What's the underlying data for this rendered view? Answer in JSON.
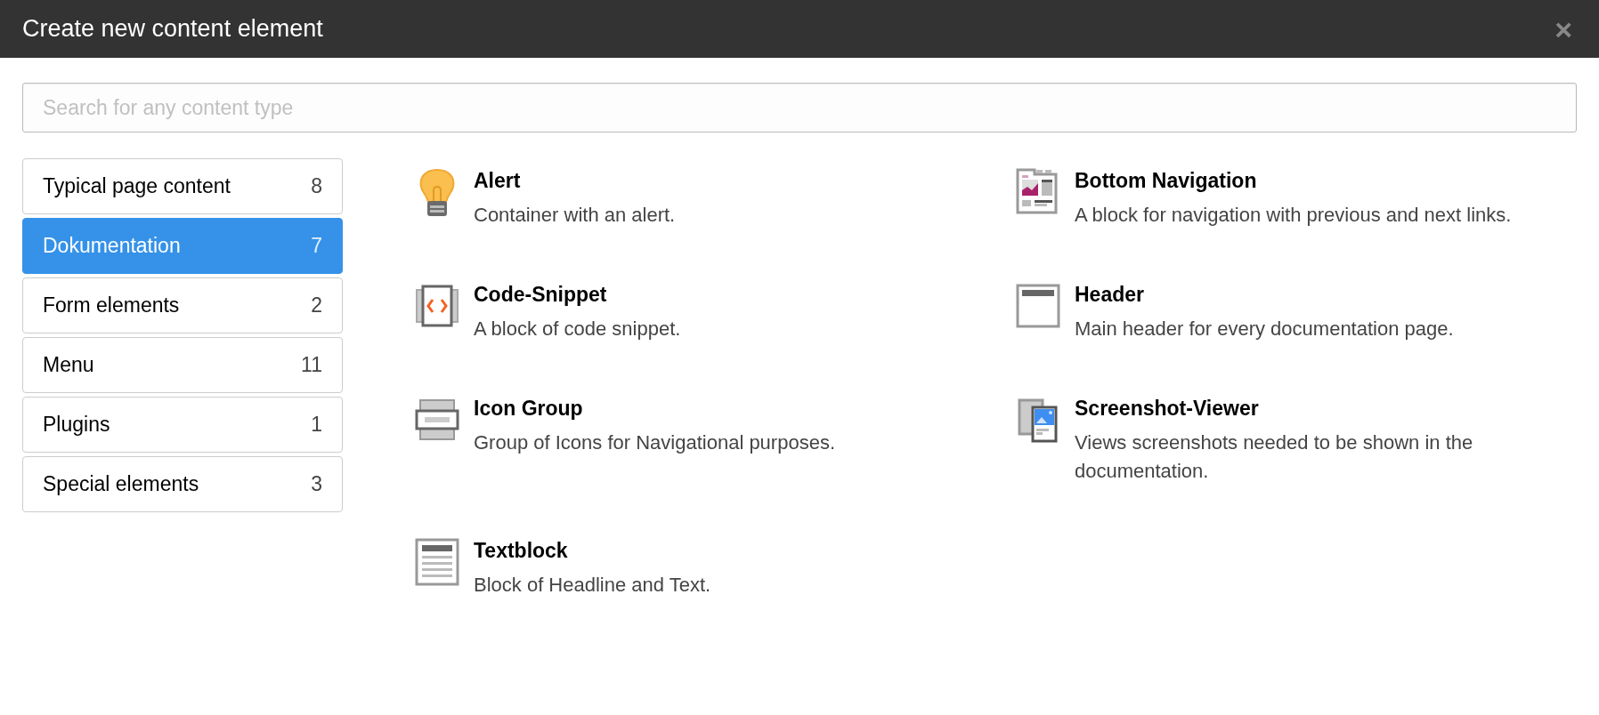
{
  "dialog": {
    "title": "Create new content element",
    "close": "×"
  },
  "search": {
    "placeholder": "Search for any content type"
  },
  "categories": [
    {
      "label": "Typical page content",
      "count": "8",
      "selected": false
    },
    {
      "label": "Dokumentation",
      "count": "7",
      "selected": true
    },
    {
      "label": "Form elements",
      "count": "2",
      "selected": false
    },
    {
      "label": "Menu",
      "count": "11",
      "selected": false
    },
    {
      "label": "Plugins",
      "count": "1",
      "selected": false
    },
    {
      "label": "Special elements",
      "count": "3",
      "selected": false
    }
  ],
  "elements": [
    {
      "kind": "bulb",
      "title": "Alert",
      "description": "Container with an alert."
    },
    {
      "kind": "navigation",
      "title": "Bottom Navigation",
      "description": "A block for navigation with previous and next links."
    },
    {
      "kind": "code",
      "title": "Code-Snippet",
      "description": "A block of code snippet."
    },
    {
      "kind": "header",
      "title": "Header",
      "description": "Main header for every documentation page."
    },
    {
      "kind": "icons",
      "title": "Icon Group",
      "description": "Group of Icons for Navigational purposes."
    },
    {
      "kind": "screenshots",
      "title": "Screenshot-Viewer",
      "description": "Views screenshots needed to be shown in the documentation."
    },
    {
      "kind": "text",
      "title": "Textblock",
      "description": "Block of Headline and Text."
    }
  ]
}
